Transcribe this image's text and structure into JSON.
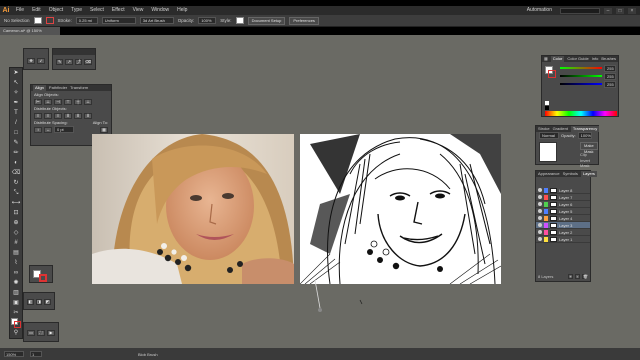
{
  "app": {
    "logo": "Ai",
    "workspace": "Automation"
  },
  "menu": [
    "File",
    "Edit",
    "Object",
    "Type",
    "Select",
    "Effect",
    "View",
    "Window",
    "Help"
  ],
  "control": {
    "selection": "No Selection",
    "stroke_label": "Stroke:",
    "stroke_weight": "0.25 mi",
    "uniform": "Uniform",
    "brush": "3d Art Brush",
    "opacity_label": "Opacity:",
    "opacity": "100%",
    "style_label": "Style:",
    "doc_setup": "Document Setup",
    "preferences": "Preferences"
  },
  "document_tab": "Cameron.ai* @ 150% (RGB/Preview)",
  "align_panel": {
    "tabs": [
      "Align",
      "Pathfinder",
      "Transform"
    ],
    "align_objects": "Align Objects:",
    "distribute_objects": "Distribute Objects:",
    "distribute_spacing": "Distribute Spacing:",
    "align_to": "Align To:",
    "spacing_value": "0 pt"
  },
  "color_panel": {
    "tabs": [
      "Color",
      "Color Guide",
      "Info",
      "Brushes"
    ],
    "values": [
      "255",
      "255",
      "255"
    ],
    "accent": "#ff0000"
  },
  "transparency_panel": {
    "tabs": [
      "Stroke",
      "Gradient",
      "Transparency"
    ],
    "blend": "Normal",
    "opacity_label": "Opacity:",
    "opacity": "100%",
    "make_mask": "Make Mask",
    "clip": "Clip",
    "invert": "Invert Mask"
  },
  "layers_panel": {
    "tabs": [
      "Appearance",
      "Symbols",
      "Layers"
    ],
    "layers": [
      {
        "name": "Layer 8",
        "color": "#4f7fff",
        "selected": false
      },
      {
        "name": "Layer 7",
        "color": "#ff4f4f",
        "selected": false
      },
      {
        "name": "Layer 6",
        "color": "#4fcf4f",
        "selected": false
      },
      {
        "name": "Layer 5",
        "color": "#4f7fff",
        "selected": false
      },
      {
        "name": "Layer 4",
        "color": "#ff9f3f",
        "selected": false
      },
      {
        "name": "Layer 3",
        "color": "#d04fff",
        "selected": true
      },
      {
        "name": "Layer 2",
        "color": "#ff4f9f",
        "selected": false
      },
      {
        "name": "Layer 1",
        "color": "#ffdf3f",
        "selected": false
      }
    ],
    "footer": "8 Layers"
  },
  "status": {
    "zoom": "150%",
    "page": "1",
    "tool": "Blob Brush"
  }
}
